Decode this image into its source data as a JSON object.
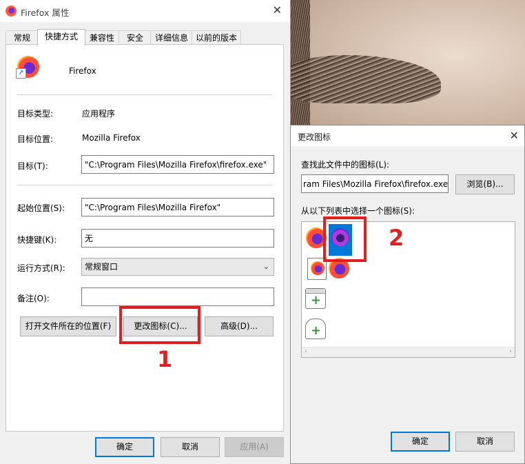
{
  "properties": {
    "title": "Firefox 属性",
    "tabs": [
      "常规",
      "快捷方式",
      "兼容性",
      "安全",
      "详细信息",
      "以前的版本"
    ],
    "app_name": "Firefox",
    "target_type_label": "目标类型:",
    "target_type_value": "应用程序",
    "target_location_label": "目标位置:",
    "target_location_value": "Mozilla Firefox",
    "target_label": "目标(T):",
    "target_value": "\"C:\\Program Files\\Mozilla Firefox\\firefox.exe\"",
    "start_in_label": "起始位置(S):",
    "start_in_value": "\"C:\\Program Files\\Mozilla Firefox\"",
    "hotkey_label": "快捷键(K):",
    "hotkey_value": "无",
    "run_label": "运行方式(R):",
    "run_value": "常规窗口",
    "comment_label": "备注(O):",
    "comment_value": "",
    "open_location_button": "打开文件所在的位置(F)",
    "change_icon_button": "更改图标(C)...",
    "advanced_button": "高级(D)...",
    "ok_button": "确定",
    "cancel_button": "取消",
    "apply_button": "应用(A)"
  },
  "change_icon": {
    "title": "更改图标",
    "find_label": "查找此文件中的图标(L):",
    "file_value": "ram Files\\Mozilla Firefox\\firefox.exe",
    "browse_button": "浏览(B)...",
    "list_label": "从以下列表中选择一个图标(S):",
    "icons": [
      "firefox-icon",
      "firefox-private-icon",
      "firefox-document-icon",
      "firefox-nightly-icon",
      "add-window-icon",
      "add-profile-icon"
    ],
    "ok_button": "确定",
    "cancel_button": "取消"
  },
  "annotations": {
    "marker_1": "1",
    "marker_2": "2",
    "color": "#e02020"
  }
}
